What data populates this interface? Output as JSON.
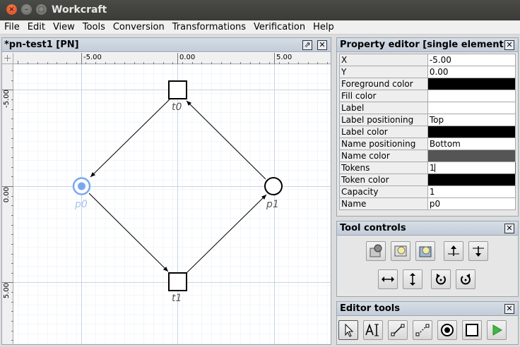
{
  "app": {
    "title": "Workcraft"
  },
  "menu": [
    "File",
    "Edit",
    "View",
    "Tools",
    "Conversion",
    "Transformations",
    "Verification",
    "Help"
  ],
  "document": {
    "title": "*pn-test1 [PN]",
    "ruler_top_labels": [
      "-5.00",
      "0.00",
      "5.00"
    ],
    "ruler_left_labels": [
      "-5.00",
      "0.00",
      "5.00"
    ],
    "nodes": {
      "t0": "t0",
      "t1": "t1",
      "p0": "p0",
      "p1": "p1"
    },
    "colors": {
      "selected": "#7aa8f0",
      "selected_label": "#a8c4ea",
      "normal": "#000000"
    }
  },
  "property_editor": {
    "title": "Property editor [single element]",
    "rows": [
      {
        "key": "X",
        "value": "-5.00"
      },
      {
        "key": "Y",
        "value": "0.00"
      },
      {
        "key": "Foreground color",
        "value": "",
        "swatch": "#000000"
      },
      {
        "key": "Fill color",
        "value": "",
        "swatch": "#ffffff"
      },
      {
        "key": "Label",
        "value": ""
      },
      {
        "key": "Label positioning",
        "value": "Top"
      },
      {
        "key": "Label color",
        "value": "",
        "swatch": "#000000"
      },
      {
        "key": "Name positioning",
        "value": "Bottom"
      },
      {
        "key": "Name color",
        "value": "",
        "swatch": "#555555"
      },
      {
        "key": "Tokens",
        "value": "1"
      },
      {
        "key": "Token color",
        "value": "",
        "swatch": "#000000"
      },
      {
        "key": "Capacity",
        "value": "1"
      },
      {
        "key": "Name",
        "value": "p0"
      }
    ]
  },
  "tool_controls": {
    "title": "Tool controls"
  },
  "editor_tools": {
    "title": "Editor tools"
  }
}
